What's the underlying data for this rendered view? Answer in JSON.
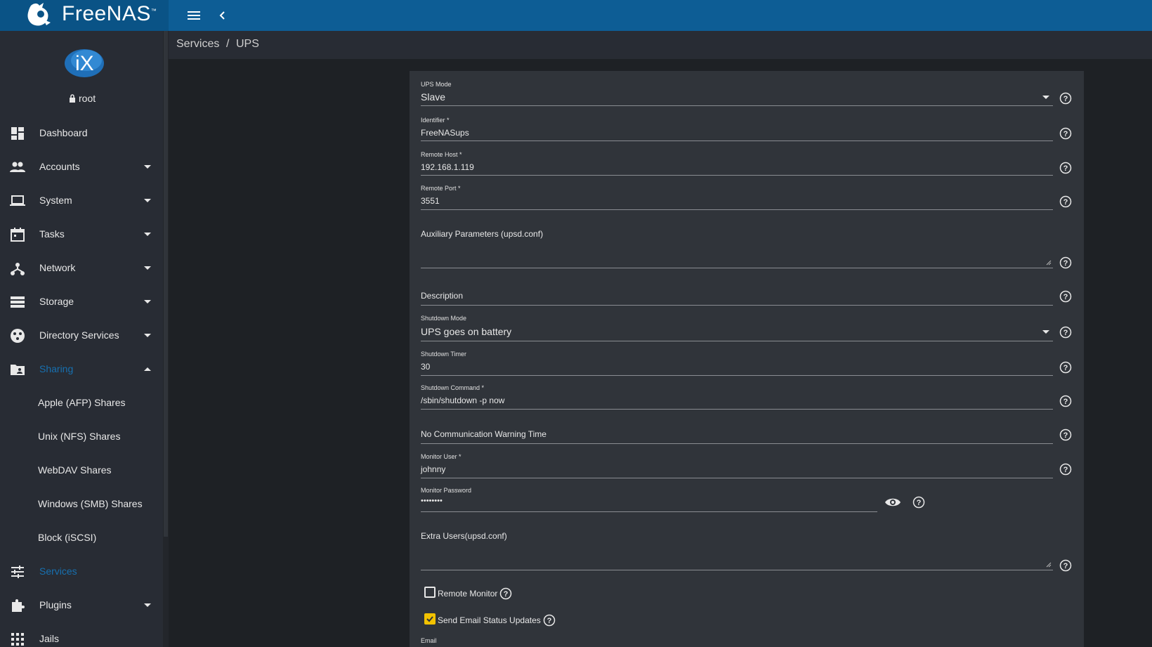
{
  "app": {
    "brand": "FreeNAS",
    "brand_tm": "™"
  },
  "user": {
    "name": "root"
  },
  "breadcrumb": {
    "parent": "Services",
    "separator": "/",
    "current": "UPS"
  },
  "nav": {
    "dashboard": "Dashboard",
    "accounts": "Accounts",
    "system": "System",
    "tasks": "Tasks",
    "network": "Network",
    "storage": "Storage",
    "directory_services": "Directory Services",
    "sharing": "Sharing",
    "sharing_children": [
      "Apple (AFP) Shares",
      "Unix (NFS) Shares",
      "WebDAV Shares",
      "Windows (SMB) Shares",
      "Block (iSCSI)"
    ],
    "services": "Services",
    "plugins": "Plugins",
    "jails": "Jails"
  },
  "form": {
    "ups_mode": {
      "label": "UPS Mode",
      "value": "Slave"
    },
    "identifier": {
      "label": "Identifier *",
      "value": "FreeNASups"
    },
    "remote_host": {
      "label": "Remote Host *",
      "value": "192.168.1.119"
    },
    "remote_port": {
      "label": "Remote Port *",
      "value": "3551"
    },
    "aux_params": {
      "label": "Auxiliary Parameters (upsd.conf)"
    },
    "description": {
      "label": "Description"
    },
    "shutdown_mode": {
      "label": "Shutdown Mode",
      "value": "UPS goes on battery"
    },
    "shutdown_timer": {
      "label": "Shutdown Timer",
      "value": "30"
    },
    "shutdown_command": {
      "label": "Shutdown Command *",
      "value": "/sbin/shutdown -p now"
    },
    "no_comm_warning": {
      "label": "No Communication Warning Time"
    },
    "monitor_user": {
      "label": "Monitor User *",
      "value": "johnny"
    },
    "monitor_password": {
      "label": "Monitor Password",
      "value": "••••••••"
    },
    "extra_users": {
      "label": "Extra Users(upsd.conf)"
    },
    "remote_monitor": {
      "label": "Remote Monitor",
      "checked": false
    },
    "send_email": {
      "label": "Send Email Status Updates",
      "checked": true
    },
    "email": {
      "label": "Email"
    }
  },
  "colors": {
    "topbar": "#0d5d95",
    "sidebar": "#282c34",
    "card": "#30343a",
    "accent": "#1770b0",
    "checkbox": "#f2c200"
  }
}
